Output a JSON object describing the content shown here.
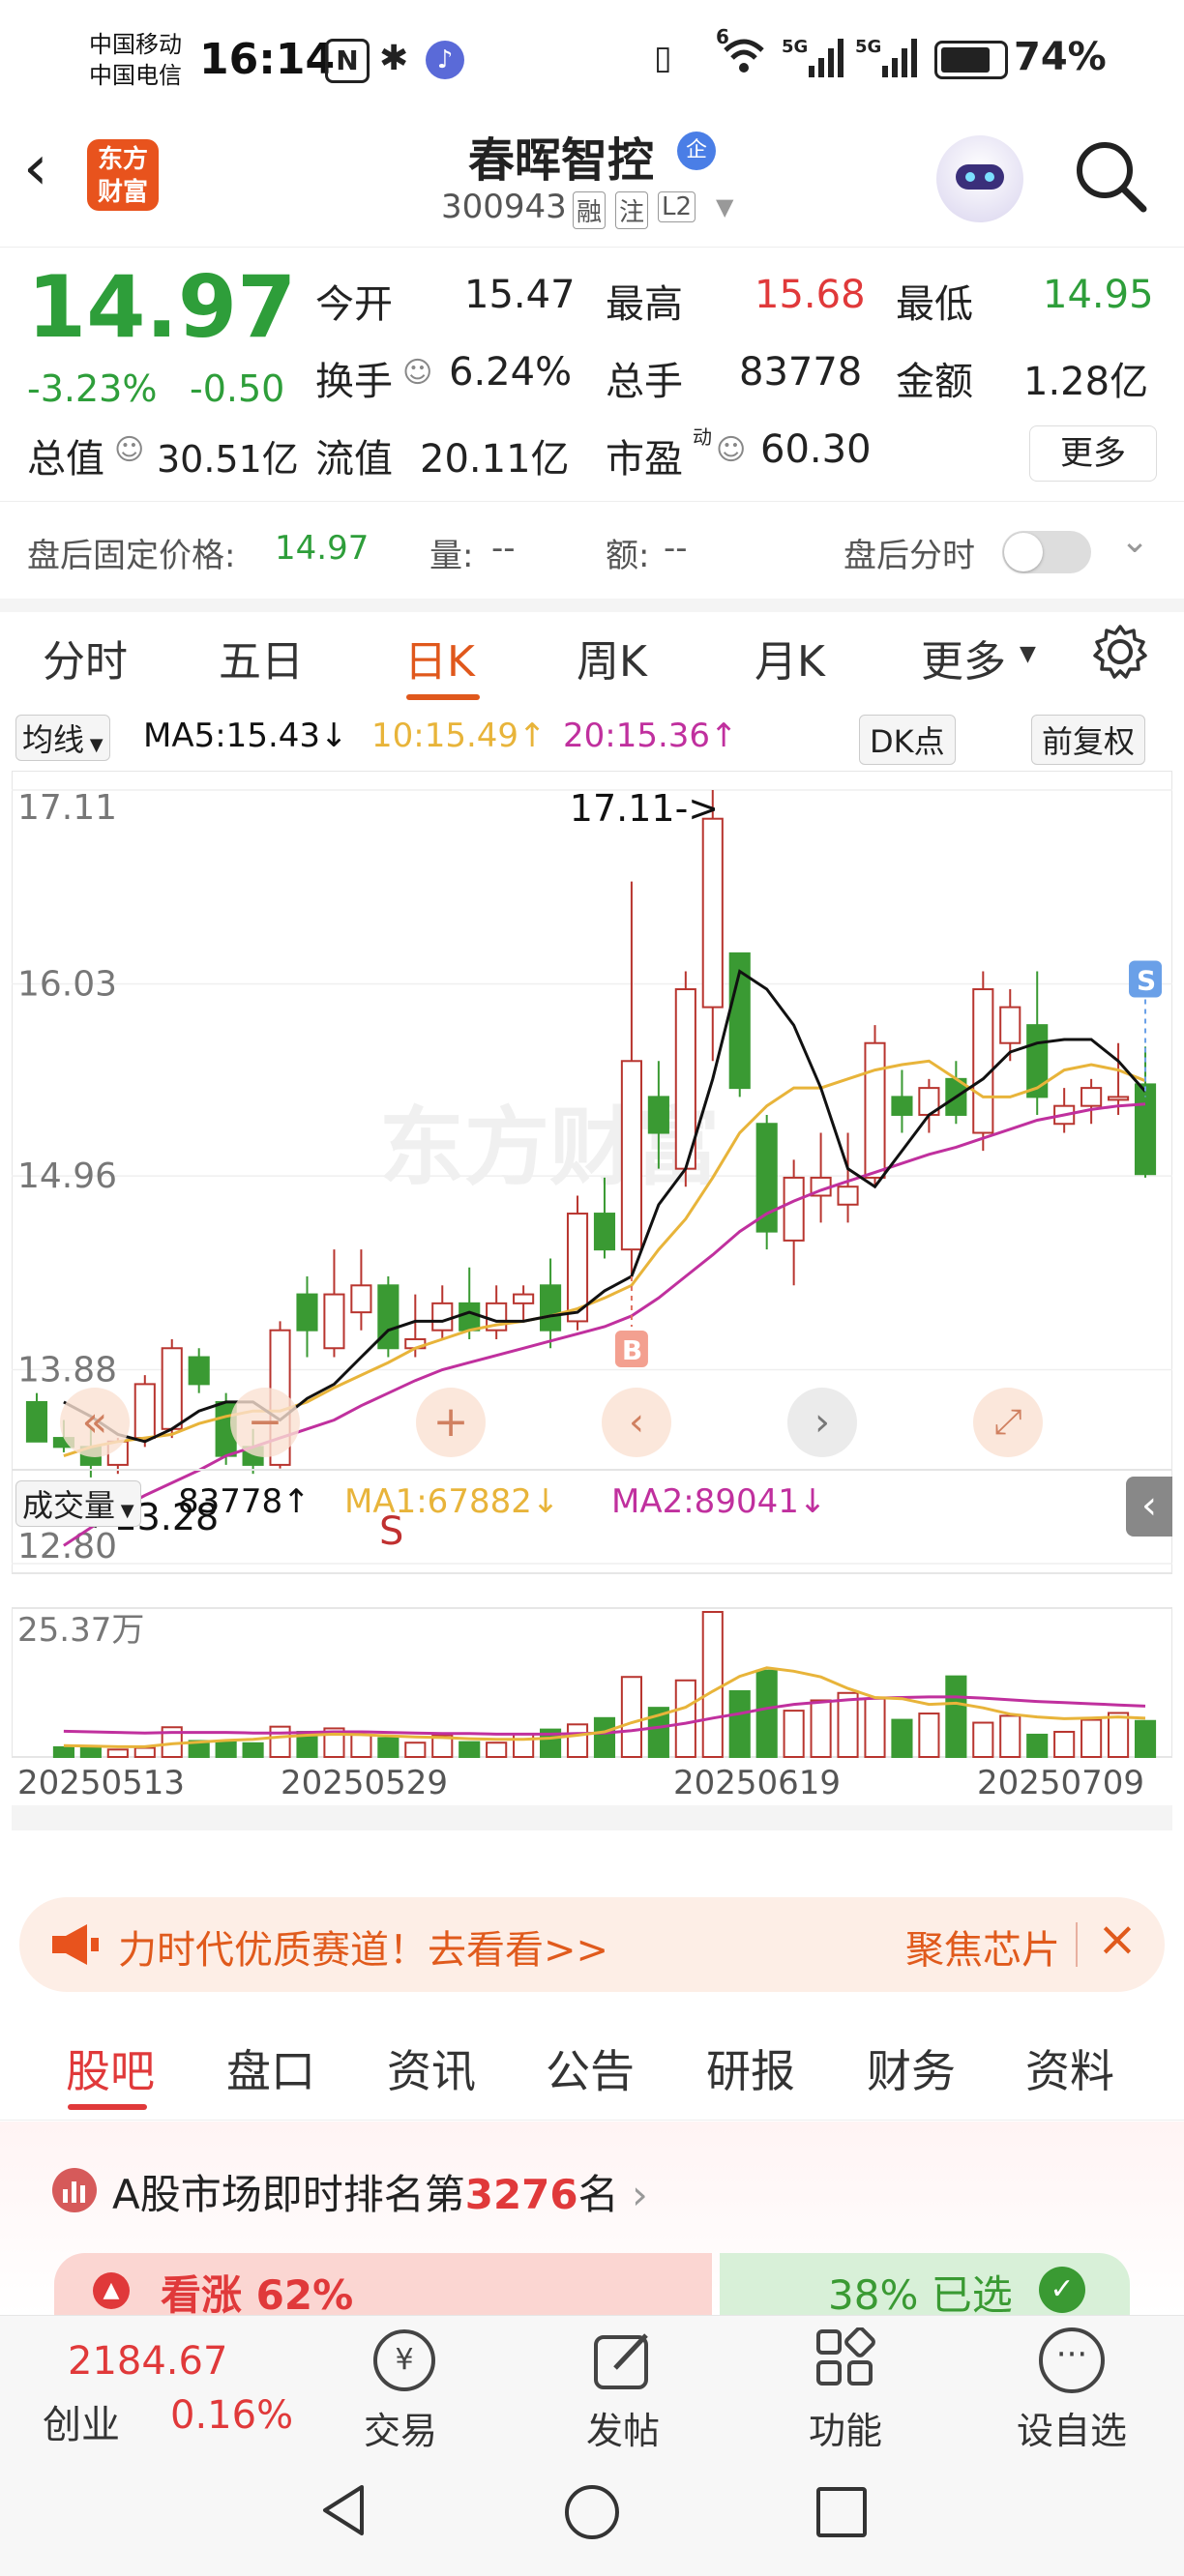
{
  "status_bar": {
    "carrier1": "中国移动",
    "carrier2": "中国电信",
    "time": "16:14",
    "battery": "74%",
    "signal1": "5G",
    "signal2": "5G",
    "wifi_badge": "6"
  },
  "header": {
    "title": "春晖智控",
    "title_badge": "企",
    "code": "300943",
    "tag1": "融",
    "tag2": "注",
    "tag3": "L2",
    "logo_line1": "东方",
    "logo_line2": "财富"
  },
  "quote": {
    "price": "14.97",
    "change_pct": "-3.23%",
    "change": "-0.50",
    "open_label": "今开",
    "open": "15.47",
    "high_label": "最高",
    "high": "15.68",
    "low_label": "最低",
    "low": "14.95",
    "turnover_label": "换手",
    "turnover": "6.24%",
    "volume_label": "总手",
    "volume": "83778",
    "amount_label": "金额",
    "amount": "1.28亿",
    "mktcap_label": "总值",
    "mktcap": "30.51亿",
    "float_label": "流值",
    "float": "20.11亿",
    "pe_label": "市盈",
    "pe_sup": "动",
    "pe": "60.30",
    "more_button": "更多"
  },
  "after_hours": {
    "price_label": "盘后固定价格:",
    "price": "14.97",
    "vol_label": "量:",
    "vol": "--",
    "amt_label": "额:",
    "amt": "--",
    "intraday_label": "盘后分时"
  },
  "chart_tabs": [
    "分时",
    "五日",
    "日K",
    "周K",
    "月K",
    "更多"
  ],
  "chart_tabs_active": 2,
  "ma_bar": {
    "selector": "均线",
    "ma5": "MA5:15.43↓",
    "ma10": "10:15.49↑",
    "ma20": "20:15.36↑",
    "dk_button": "DK点",
    "adjust_button": "前复权"
  },
  "kline": {
    "y_labels": [
      "17.11",
      "16.03",
      "14.96",
      "13.88",
      "12.80"
    ],
    "high_annot": "17.11->",
    "low_annot": "<-13.28",
    "buy_marker": "B",
    "sell_marker": "S",
    "s_marker_left": "S",
    "watermark": "东方财富"
  },
  "volume_bar": {
    "selector": "成交量",
    "vol": "83778↑",
    "ma1": "MA1:67882↓",
    "ma2": "MA2:89041↓",
    "max_label": "25.37万"
  },
  "dates": [
    "20250513",
    "20250529",
    "20250619",
    "20250709"
  ],
  "colors": {
    "up": "#b8352f",
    "down": "#3a9a33",
    "ma5": "#111111",
    "ma10": "#e8b43a",
    "ma20": "#c0309e",
    "accent": "#e05a1c"
  },
  "chart_data": {
    "type": "candlestick",
    "candles": [
      {
        "o": 13.7,
        "h": 13.75,
        "l": 13.48,
        "c": 13.48
      },
      {
        "o": 13.5,
        "h": 13.6,
        "l": 13.42,
        "c": 13.45
      },
      {
        "o": 13.45,
        "h": 13.55,
        "l": 13.28,
        "c": 13.35
      },
      {
        "o": 13.35,
        "h": 13.5,
        "l": 13.3,
        "c": 13.48
      },
      {
        "o": 13.5,
        "h": 13.85,
        "l": 13.45,
        "c": 13.8
      },
      {
        "o": 13.55,
        "h": 14.05,
        "l": 13.5,
        "c": 14.0
      },
      {
        "o": 13.95,
        "h": 14.0,
        "l": 13.75,
        "c": 13.8
      },
      {
        "o": 13.7,
        "h": 13.75,
        "l": 13.35,
        "c": 13.4
      },
      {
        "o": 13.45,
        "h": 13.55,
        "l": 13.3,
        "c": 13.35
      },
      {
        "o": 13.35,
        "h": 14.15,
        "l": 13.33,
        "c": 14.1
      },
      {
        "o": 14.3,
        "h": 14.4,
        "l": 13.95,
        "c": 14.1
      },
      {
        "o": 14.0,
        "h": 14.55,
        "l": 13.95,
        "c": 14.3
      },
      {
        "o": 14.2,
        "h": 14.55,
        "l": 14.1,
        "c": 14.35
      },
      {
        "o": 14.35,
        "h": 14.4,
        "l": 13.95,
        "c": 14.0
      },
      {
        "o": 14.0,
        "h": 14.3,
        "l": 13.95,
        "c": 14.05
      },
      {
        "o": 14.1,
        "h": 14.35,
        "l": 14.05,
        "c": 14.25
      },
      {
        "o": 14.25,
        "h": 14.45,
        "l": 14.05,
        "c": 14.1
      },
      {
        "o": 14.1,
        "h": 14.35,
        "l": 14.05,
        "c": 14.25
      },
      {
        "o": 14.25,
        "h": 14.35,
        "l": 14.15,
        "c": 14.3
      },
      {
        "o": 14.35,
        "h": 14.5,
        "l": 14.0,
        "c": 14.1
      },
      {
        "o": 14.15,
        "h": 14.85,
        "l": 14.1,
        "c": 14.75
      },
      {
        "o": 14.75,
        "h": 14.95,
        "l": 14.5,
        "c": 14.55
      },
      {
        "o": 14.55,
        "h": 16.6,
        "l": 14.4,
        "c": 15.6
      },
      {
        "o": 15.4,
        "h": 15.6,
        "l": 15.0,
        "c": 15.2
      },
      {
        "o": 15.0,
        "h": 16.1,
        "l": 14.9,
        "c": 16.0
      },
      {
        "o": 15.9,
        "h": 17.11,
        "l": 15.6,
        "c": 16.95
      },
      {
        "o": 16.2,
        "h": 16.2,
        "l": 15.4,
        "c": 15.45
      },
      {
        "o": 15.25,
        "h": 15.3,
        "l": 14.55,
        "c": 14.65
      },
      {
        "o": 14.6,
        "h": 15.05,
        "l": 14.35,
        "c": 14.95
      },
      {
        "o": 14.85,
        "h": 15.2,
        "l": 14.7,
        "c": 14.95
      },
      {
        "o": 14.8,
        "h": 15.2,
        "l": 14.7,
        "c": 14.9
      },
      {
        "o": 14.95,
        "h": 15.8,
        "l": 14.9,
        "c": 15.7
      },
      {
        "o": 15.4,
        "h": 15.55,
        "l": 15.2,
        "c": 15.3
      },
      {
        "o": 15.3,
        "h": 15.5,
        "l": 15.2,
        "c": 15.45
      },
      {
        "o": 15.5,
        "h": 15.6,
        "l": 15.25,
        "c": 15.3
      },
      {
        "o": 15.2,
        "h": 16.1,
        "l": 15.1,
        "c": 16.0
      },
      {
        "o": 15.7,
        "h": 16.0,
        "l": 15.6,
        "c": 15.9
      },
      {
        "o": 15.8,
        "h": 16.1,
        "l": 15.3,
        "c": 15.4
      },
      {
        "o": 15.25,
        "h": 15.45,
        "l": 15.2,
        "c": 15.35
      },
      {
        "o": 15.35,
        "h": 15.5,
        "l": 15.25,
        "c": 15.45
      },
      {
        "o": 15.4,
        "h": 15.7,
        "l": 15.3,
        "c": 15.4
      },
      {
        "o": 15.47,
        "h": 15.68,
        "l": 14.95,
        "c": 14.97
      }
    ],
    "ma5": [
      13.7,
      13.62,
      13.52,
      13.48,
      13.55,
      13.65,
      13.7,
      13.7,
      13.6,
      13.72,
      13.8,
      13.95,
      14.1,
      14.15,
      14.15,
      14.2,
      14.15,
      14.15,
      14.18,
      14.2,
      14.32,
      14.4,
      14.8,
      15.0,
      15.5,
      16.1,
      16.0,
      15.8,
      15.45,
      15.0,
      14.9,
      15.1,
      15.3,
      15.4,
      15.5,
      15.65,
      15.7,
      15.72,
      15.72,
      15.6,
      15.43
    ],
    "ma10": [
      13.4,
      13.45,
      13.48,
      13.5,
      13.52,
      13.58,
      13.62,
      13.65,
      13.65,
      13.7,
      13.78,
      13.85,
      13.92,
      14.0,
      14.05,
      14.1,
      14.13,
      14.15,
      14.18,
      14.22,
      14.28,
      14.35,
      14.55,
      14.72,
      14.95,
      15.2,
      15.35,
      15.45,
      15.45,
      15.5,
      15.55,
      15.58,
      15.6,
      15.5,
      15.4,
      15.4,
      15.45,
      15.55,
      15.58,
      15.55,
      15.49
    ],
    "ma20": [
      12.9,
      13.0,
      13.1,
      13.18,
      13.25,
      13.32,
      13.4,
      13.45,
      13.5,
      13.55,
      13.6,
      13.68,
      13.75,
      13.82,
      13.88,
      13.92,
      13.96,
      14.0,
      14.04,
      14.08,
      14.12,
      14.18,
      14.28,
      14.4,
      14.52,
      14.65,
      14.75,
      14.82,
      14.88,
      14.93,
      14.98,
      15.03,
      15.08,
      15.12,
      15.17,
      15.22,
      15.27,
      15.3,
      15.33,
      15.35,
      15.36
    ],
    "volume": [
      1.7,
      1.6,
      1.3,
      1.6,
      5.2,
      2.8,
      2.7,
      2.4,
      5.3,
      4.4,
      5.0,
      3.9,
      3.3,
      2.5,
      3.8,
      2.6,
      2.5,
      4.0,
      4.8,
      5.7,
      6.8,
      14.0,
      8.6,
      13.4,
      25.37,
      11.5,
      15.1,
      8.1,
      9.9,
      11.2,
      10.2,
      6.5,
      7.6,
      14.1,
      6.0,
      7.2,
      3.9,
      4.4,
      6.5,
      7.7,
      6.3
    ],
    "vol_ma1": [
      2.0,
      1.9,
      1.8,
      1.8,
      2.3,
      2.6,
      2.9,
      3.1,
      3.5,
      3.8,
      4.0,
      3.9,
      3.7,
      3.5,
      3.4,
      3.2,
      3.1,
      3.1,
      3.3,
      3.8,
      4.4,
      6.0,
      7.3,
      8.7,
      11.5,
      14.1,
      15.6,
      15.0,
      14.0,
      12.0,
      10.4,
      10.2,
      9.2,
      9.4,
      8.6,
      7.5,
      7.0,
      6.7,
      6.8,
      7.0,
      6.79
    ],
    "vol_ma2": [
      4.5,
      4.4,
      4.3,
      4.2,
      4.3,
      4.3,
      4.3,
      4.2,
      4.2,
      4.3,
      4.4,
      4.4,
      4.3,
      4.2,
      4.1,
      4.1,
      4.0,
      4.0,
      4.0,
      4.1,
      4.2,
      4.6,
      5.2,
      5.9,
      6.8,
      7.6,
      8.5,
      9.2,
      9.6,
      10.0,
      10.3,
      10.4,
      10.5,
      10.5,
      10.3,
      10.0,
      9.7,
      9.5,
      9.3,
      9.1,
      8.9
    ],
    "ylim": [
      12.8,
      17.11
    ]
  },
  "banner": {
    "text": "力时代优质赛道！去看看>>",
    "right_text": "聚焦芯片"
  },
  "news_tabs": [
    "股吧",
    "盘口",
    "资讯",
    "公告",
    "研报",
    "财务",
    "资料"
  ],
  "news_tabs_active": 0,
  "rank": {
    "prefix": "A股市场即时排名第",
    "rank": "3276",
    "suffix": "名",
    "bull": "看涨 62%",
    "bear": "38% 已选"
  },
  "bottom_nav": {
    "index_value": "2184.67",
    "index_name": "创业",
    "index_pct": "0.16%",
    "trade": "交易",
    "post": "发帖",
    "function": "功能",
    "watchlist": "设自选"
  }
}
